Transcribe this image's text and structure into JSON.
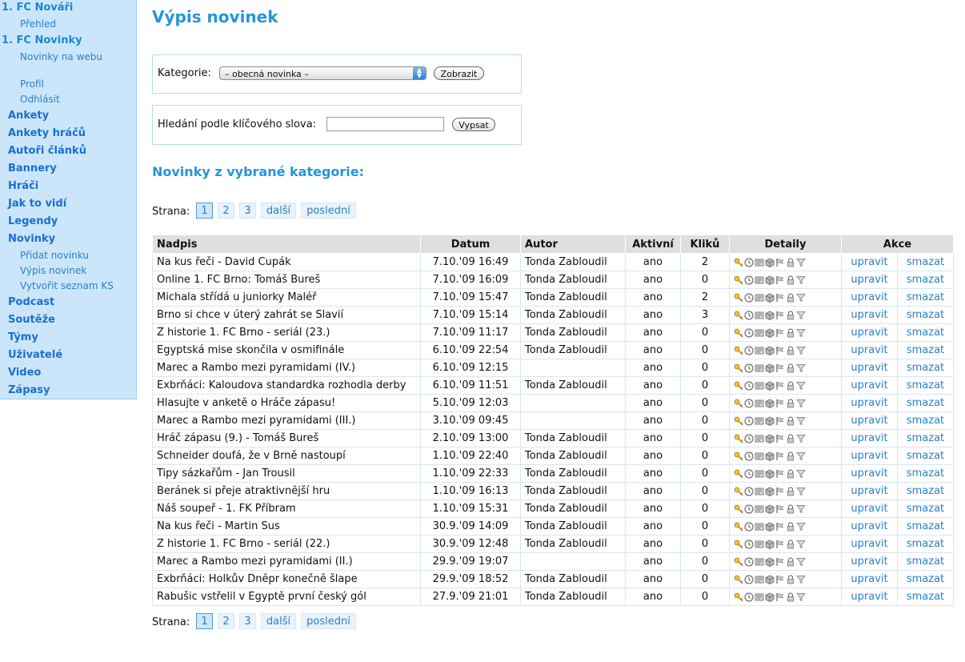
{
  "sidebar": {
    "section1_title": "1. FC Nováři",
    "section1_sub": "Přehled",
    "section2_title": "1. FC Novinky",
    "section2_sub": "Novinky na webu",
    "profile": "Profil",
    "logout": "Odhlásit",
    "items": [
      "Ankety",
      "Ankety hráčů",
      "Autoři článků",
      "Bannery",
      "Hráči",
      "Jak to vidí",
      "Legendy",
      "Novinky"
    ],
    "novinky_sub": [
      "Přidat novinku",
      "Výpis novinek",
      "Vytvořit seznam KS"
    ],
    "items_after": [
      "Podcast",
      "Soutěže",
      "Týmy",
      "Uživatelé",
      "Video",
      "Zápasy"
    ]
  },
  "page_title": "Výpis novinek",
  "category": {
    "label": "Kategorie:",
    "selected": "– obecná novinka –",
    "button": "Zobrazit"
  },
  "search": {
    "label": "Hledání podle klíčového slova:",
    "value": "",
    "button": "Vypsat"
  },
  "subtitle": "Novinky z vybrané kategorie:",
  "pager": {
    "label": "Strana:",
    "pages": [
      "1",
      "2",
      "3"
    ],
    "current": "1",
    "next": "další",
    "last": "poslední"
  },
  "table": {
    "headers": [
      "Nadpis",
      "Datum",
      "Autor",
      "Aktivní",
      "Kliků",
      "Detaily",
      "Akce"
    ],
    "edit_label": "upravit",
    "delete_label": "smazat",
    "rows": [
      [
        "Na kus řeči - David Cupák",
        "7.10.'09 16:49",
        "Tonda Zabloudil",
        "ano",
        "2"
      ],
      [
        "Online 1. FC Brno: Tomáš Bureš",
        "7.10.'09 16:09",
        "Tonda Zabloudil",
        "ano",
        "0"
      ],
      [
        "Michala střídá u juniorky Maléř",
        "7.10.'09 15:47",
        "Tonda Zabloudil",
        "ano",
        "2"
      ],
      [
        "Brno si chce v úterý zahrát se Slavií",
        "7.10.'09 15:14",
        "Tonda Zabloudil",
        "ano",
        "3"
      ],
      [
        "Z historie 1. FC Brno - seriál (23.)",
        "7.10.'09 11:17",
        "Tonda Zabloudil",
        "ano",
        "0"
      ],
      [
        "Egyptská mise skončila v osmifinále",
        "6.10.'09 22:54",
        "Tonda Zabloudil",
        "ano",
        "0"
      ],
      [
        "Marec a Rambo mezi pyramidami (IV.)",
        "6.10.'09 12:15",
        "",
        "ano",
        "0"
      ],
      [
        "Exbrňáci: Kaloudova standardka rozhodla derby",
        "6.10.'09 11:51",
        "Tonda Zabloudil",
        "ano",
        "0"
      ],
      [
        "Hlasujte v anketě o Hráče zápasu!",
        "5.10.'09 12:03",
        "",
        "ano",
        "0"
      ],
      [
        "Marec a Rambo mezi pyramidami (III.)",
        "3.10.'09 09:45",
        "",
        "ano",
        "0"
      ],
      [
        "Hráč zápasu (9.) - Tomáš Bureš",
        "2.10.'09 13:00",
        "Tonda Zabloudil",
        "ano",
        "0"
      ],
      [
        "Schneider doufá, že v Brně nastoupí",
        "1.10.'09 22:40",
        "Tonda Zabloudil",
        "ano",
        "0"
      ],
      [
        "Tipy sázkařům - Jan Trousil",
        "1.10.'09 22:33",
        "Tonda Zabloudil",
        "ano",
        "0"
      ],
      [
        "Beránek si přeje atraktivnější hru",
        "1.10.'09 16:13",
        "Tonda Zabloudil",
        "ano",
        "0"
      ],
      [
        "Náš soupeř - 1. FK Příbram",
        "1.10.'09 15:31",
        "Tonda Zabloudil",
        "ano",
        "0"
      ],
      [
        "Na kus řeči - Martin Sus",
        "30.9.'09 14:09",
        "Tonda Zabloudil",
        "ano",
        "0"
      ],
      [
        "Z historie 1. FC Brno - seriál (22.)",
        "30.9.'09 12:48",
        "Tonda Zabloudil",
        "ano",
        "0"
      ],
      [
        "Marec a Rambo mezi pyramidami (II.)",
        "29.9.'09 19:07",
        "",
        "ano",
        "0"
      ],
      [
        "Exbrňáci: Holkův Dněpr konečně šlape",
        "29.9.'09 18:52",
        "Tonda Zabloudil",
        "ano",
        "0"
      ],
      [
        "Rabušic vstřelil v Egyptě první český gól",
        "27.9.'09 21:01",
        "Tonda Zabloudil",
        "ano",
        "0"
      ]
    ]
  },
  "detail_icons": [
    "key-icon",
    "clock-icon",
    "card-icon",
    "box-icon",
    "flag-icon",
    "lock-icon",
    "filter-icon"
  ],
  "colors": {
    "accent": "#2695d9",
    "link": "#2a7fc8",
    "sidebar_bg": "#cbe6fb"
  }
}
